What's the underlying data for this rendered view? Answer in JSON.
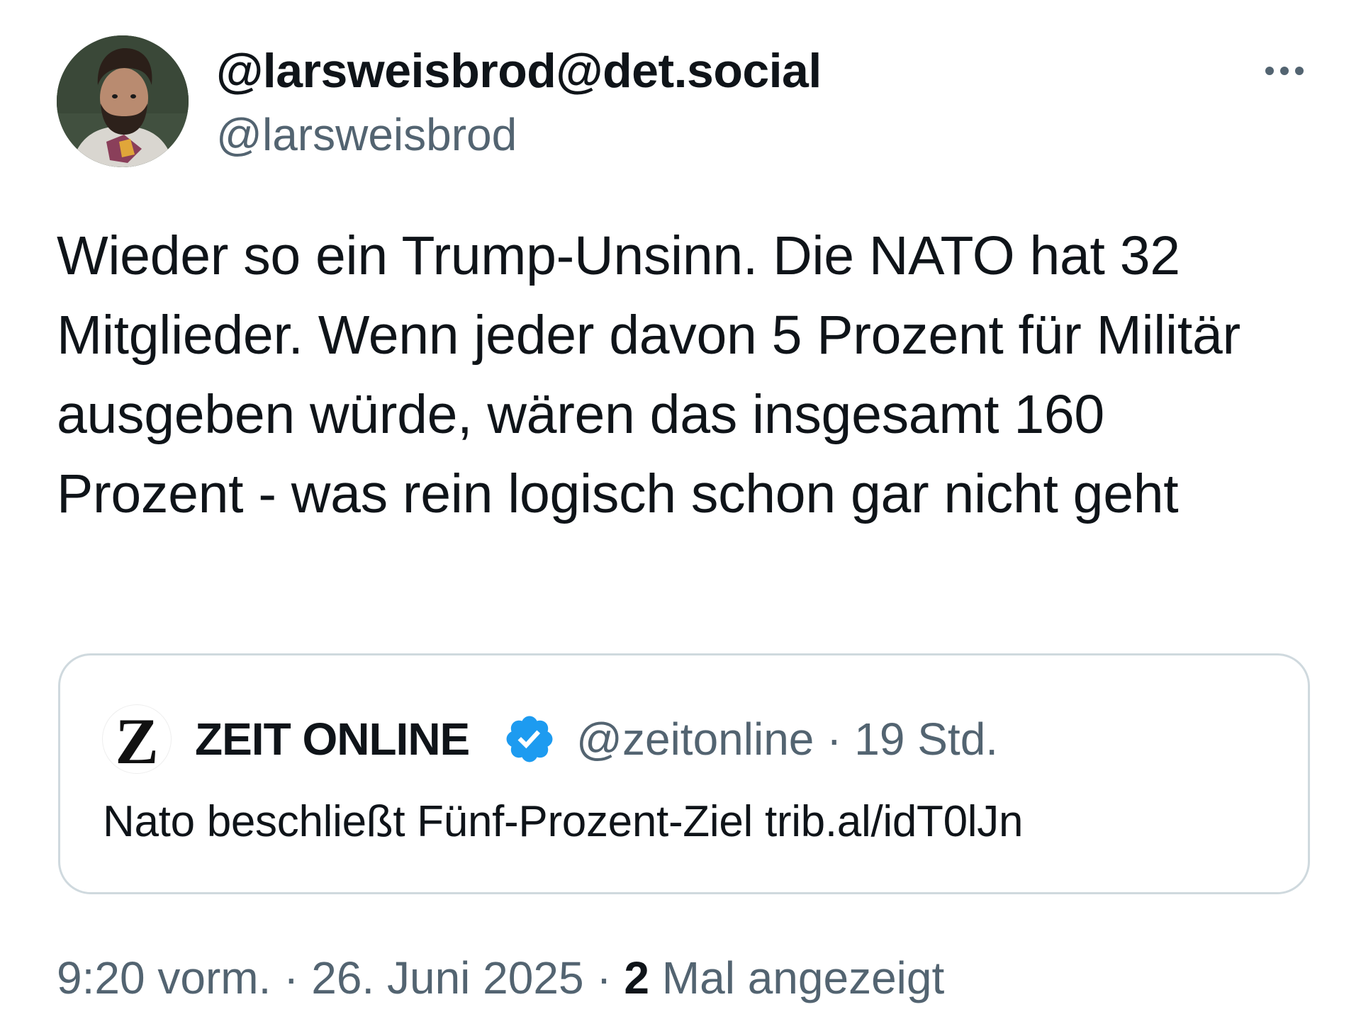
{
  "author": {
    "display_name": "@larsweisbrod@det.social",
    "handle": "@larsweisbrod",
    "avatar_icon": "person-avatar"
  },
  "menu": {
    "more_icon": "more-horizontal-icon"
  },
  "tweet": {
    "text": "Wieder so ein Trump-Unsinn. Die NATO hat 32 Mitglieder. Wenn jeder davon 5 Prozent für Militär ausgeben würde, wären das insgesamt 160 Prozent - was rein logisch schon gar nicht geht"
  },
  "quote": {
    "logo_letter": "Z",
    "name": "ZEIT ONLINE",
    "verified_icon": "verified-badge-icon",
    "verified_color": "#1d9bf0",
    "handle": "@zeitonline",
    "separator": "·",
    "time": "19 Std.",
    "text": "Nato beschließt Fünf-Prozent-Ziel trib.al/idT0lJn"
  },
  "footer": {
    "time": "9:20 vorm.",
    "separator": "·",
    "date": "26. Juni 2025",
    "views_count": "2",
    "views_label": "Mal angezeigt"
  },
  "colors": {
    "text_primary": "#0f1419",
    "text_secondary": "#536471",
    "border": "#cfd9de"
  }
}
